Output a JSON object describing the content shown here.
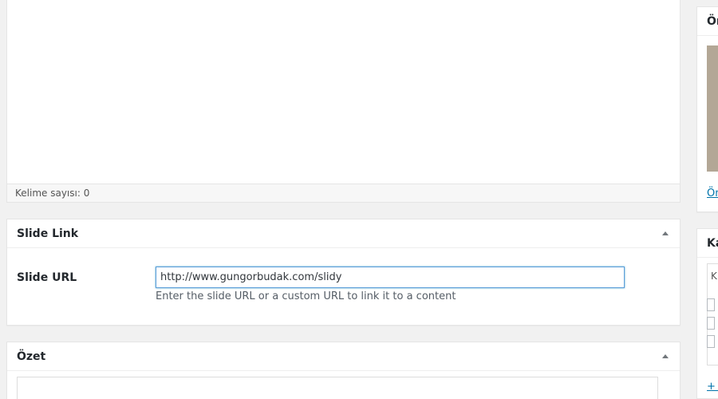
{
  "editor": {
    "word_count": "Kelime sayısı: 0"
  },
  "slide_link_box": {
    "title": "Slide Link",
    "field_label": "Slide URL",
    "url_value": "http://www.gungorbudak.com/slidy",
    "description": "Enter the slide URL or a custom URL to link it to a content"
  },
  "excerpt_box": {
    "title": "Özet"
  },
  "sidebar": {
    "box1_title": "Ön",
    "box1_link": "Ön",
    "box2_title": "Ka",
    "box2_list_first": "K",
    "box2_link": "+ Y"
  },
  "colors": {
    "background": "#f1f1f1",
    "link": "#0073aa",
    "input_focus": "#5b9dd9",
    "featured_image": "#b3a796"
  }
}
